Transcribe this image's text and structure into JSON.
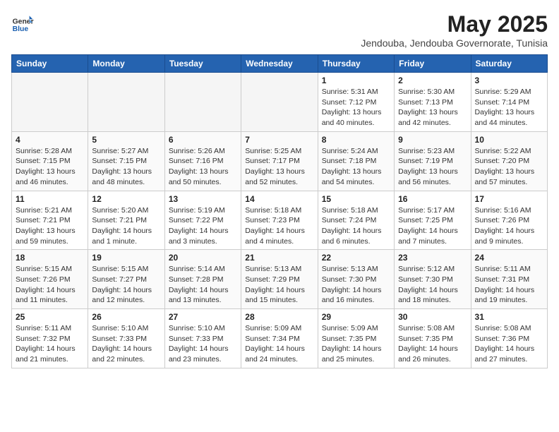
{
  "logo": {
    "general": "General",
    "blue": "Blue"
  },
  "title": "May 2025",
  "location": "Jendouba, Jendouba Governorate, Tunisia",
  "weekdays": [
    "Sunday",
    "Monday",
    "Tuesday",
    "Wednesday",
    "Thursday",
    "Friday",
    "Saturday"
  ],
  "weeks": [
    [
      {
        "day": "",
        "info": ""
      },
      {
        "day": "",
        "info": ""
      },
      {
        "day": "",
        "info": ""
      },
      {
        "day": "",
        "info": ""
      },
      {
        "day": "1",
        "info": "Sunrise: 5:31 AM\nSunset: 7:12 PM\nDaylight: 13 hours\nand 40 minutes."
      },
      {
        "day": "2",
        "info": "Sunrise: 5:30 AM\nSunset: 7:13 PM\nDaylight: 13 hours\nand 42 minutes."
      },
      {
        "day": "3",
        "info": "Sunrise: 5:29 AM\nSunset: 7:14 PM\nDaylight: 13 hours\nand 44 minutes."
      }
    ],
    [
      {
        "day": "4",
        "info": "Sunrise: 5:28 AM\nSunset: 7:15 PM\nDaylight: 13 hours\nand 46 minutes."
      },
      {
        "day": "5",
        "info": "Sunrise: 5:27 AM\nSunset: 7:15 PM\nDaylight: 13 hours\nand 48 minutes."
      },
      {
        "day": "6",
        "info": "Sunrise: 5:26 AM\nSunset: 7:16 PM\nDaylight: 13 hours\nand 50 minutes."
      },
      {
        "day": "7",
        "info": "Sunrise: 5:25 AM\nSunset: 7:17 PM\nDaylight: 13 hours\nand 52 minutes."
      },
      {
        "day": "8",
        "info": "Sunrise: 5:24 AM\nSunset: 7:18 PM\nDaylight: 13 hours\nand 54 minutes."
      },
      {
        "day": "9",
        "info": "Sunrise: 5:23 AM\nSunset: 7:19 PM\nDaylight: 13 hours\nand 56 minutes."
      },
      {
        "day": "10",
        "info": "Sunrise: 5:22 AM\nSunset: 7:20 PM\nDaylight: 13 hours\nand 57 minutes."
      }
    ],
    [
      {
        "day": "11",
        "info": "Sunrise: 5:21 AM\nSunset: 7:21 PM\nDaylight: 13 hours\nand 59 minutes."
      },
      {
        "day": "12",
        "info": "Sunrise: 5:20 AM\nSunset: 7:21 PM\nDaylight: 14 hours\nand 1 minute."
      },
      {
        "day": "13",
        "info": "Sunrise: 5:19 AM\nSunset: 7:22 PM\nDaylight: 14 hours\nand 3 minutes."
      },
      {
        "day": "14",
        "info": "Sunrise: 5:18 AM\nSunset: 7:23 PM\nDaylight: 14 hours\nand 4 minutes."
      },
      {
        "day": "15",
        "info": "Sunrise: 5:18 AM\nSunset: 7:24 PM\nDaylight: 14 hours\nand 6 minutes."
      },
      {
        "day": "16",
        "info": "Sunrise: 5:17 AM\nSunset: 7:25 PM\nDaylight: 14 hours\nand 7 minutes."
      },
      {
        "day": "17",
        "info": "Sunrise: 5:16 AM\nSunset: 7:26 PM\nDaylight: 14 hours\nand 9 minutes."
      }
    ],
    [
      {
        "day": "18",
        "info": "Sunrise: 5:15 AM\nSunset: 7:26 PM\nDaylight: 14 hours\nand 11 minutes."
      },
      {
        "day": "19",
        "info": "Sunrise: 5:15 AM\nSunset: 7:27 PM\nDaylight: 14 hours\nand 12 minutes."
      },
      {
        "day": "20",
        "info": "Sunrise: 5:14 AM\nSunset: 7:28 PM\nDaylight: 14 hours\nand 13 minutes."
      },
      {
        "day": "21",
        "info": "Sunrise: 5:13 AM\nSunset: 7:29 PM\nDaylight: 14 hours\nand 15 minutes."
      },
      {
        "day": "22",
        "info": "Sunrise: 5:13 AM\nSunset: 7:30 PM\nDaylight: 14 hours\nand 16 minutes."
      },
      {
        "day": "23",
        "info": "Sunrise: 5:12 AM\nSunset: 7:30 PM\nDaylight: 14 hours\nand 18 minutes."
      },
      {
        "day": "24",
        "info": "Sunrise: 5:11 AM\nSunset: 7:31 PM\nDaylight: 14 hours\nand 19 minutes."
      }
    ],
    [
      {
        "day": "25",
        "info": "Sunrise: 5:11 AM\nSunset: 7:32 PM\nDaylight: 14 hours\nand 21 minutes."
      },
      {
        "day": "26",
        "info": "Sunrise: 5:10 AM\nSunset: 7:33 PM\nDaylight: 14 hours\nand 22 minutes."
      },
      {
        "day": "27",
        "info": "Sunrise: 5:10 AM\nSunset: 7:33 PM\nDaylight: 14 hours\nand 23 minutes."
      },
      {
        "day": "28",
        "info": "Sunrise: 5:09 AM\nSunset: 7:34 PM\nDaylight: 14 hours\nand 24 minutes."
      },
      {
        "day": "29",
        "info": "Sunrise: 5:09 AM\nSunset: 7:35 PM\nDaylight: 14 hours\nand 25 minutes."
      },
      {
        "day": "30",
        "info": "Sunrise: 5:08 AM\nSunset: 7:35 PM\nDaylight: 14 hours\nand 26 minutes."
      },
      {
        "day": "31",
        "info": "Sunrise: 5:08 AM\nSunset: 7:36 PM\nDaylight: 14 hours\nand 27 minutes."
      }
    ]
  ]
}
